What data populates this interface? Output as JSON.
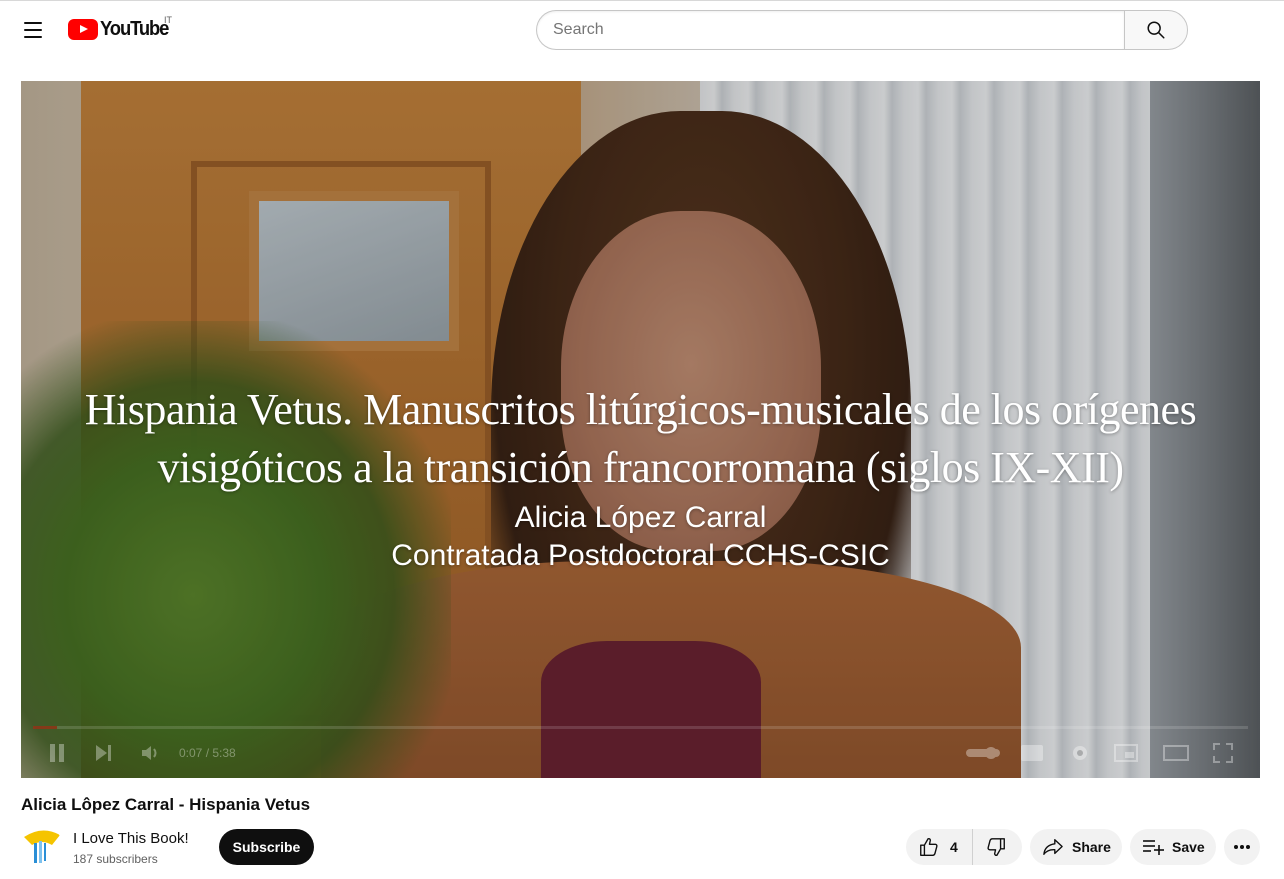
{
  "header": {
    "logo_text": "YouTube",
    "region_code": "IT",
    "search_placeholder": "Search",
    "icons": {
      "menu": "hamburger-icon",
      "search": "magnifier-icon"
    }
  },
  "player": {
    "overlay": {
      "title_line1": "Hispania Vetus. Manuscritos litúrgicos-musicales de los orígenes",
      "title_line2": "visigóticos a la transición francorromana (siglos IX-XII)",
      "author": "Alicia López Carral",
      "role": "Contratada Postdoctoral CCHS-CSIC"
    },
    "time_current": "0:07",
    "time_total": "5:38",
    "time_display": "0:07 / 5:38",
    "progress_fraction": 0.02
  },
  "video": {
    "title": "Alicia Lôpez Carral - Hispania Vetus"
  },
  "channel": {
    "name": "I Love This Book!",
    "subscribers": "187 subscribers",
    "subscribe_label": "Subscribe"
  },
  "actions": {
    "like_count": "4",
    "share_label": "Share",
    "save_label": "Save"
  },
  "colors": {
    "brand_red": "#ff0000",
    "text_primary": "#0f0f0f",
    "text_secondary": "#606060",
    "pill_bg": "#f2f2f2"
  }
}
